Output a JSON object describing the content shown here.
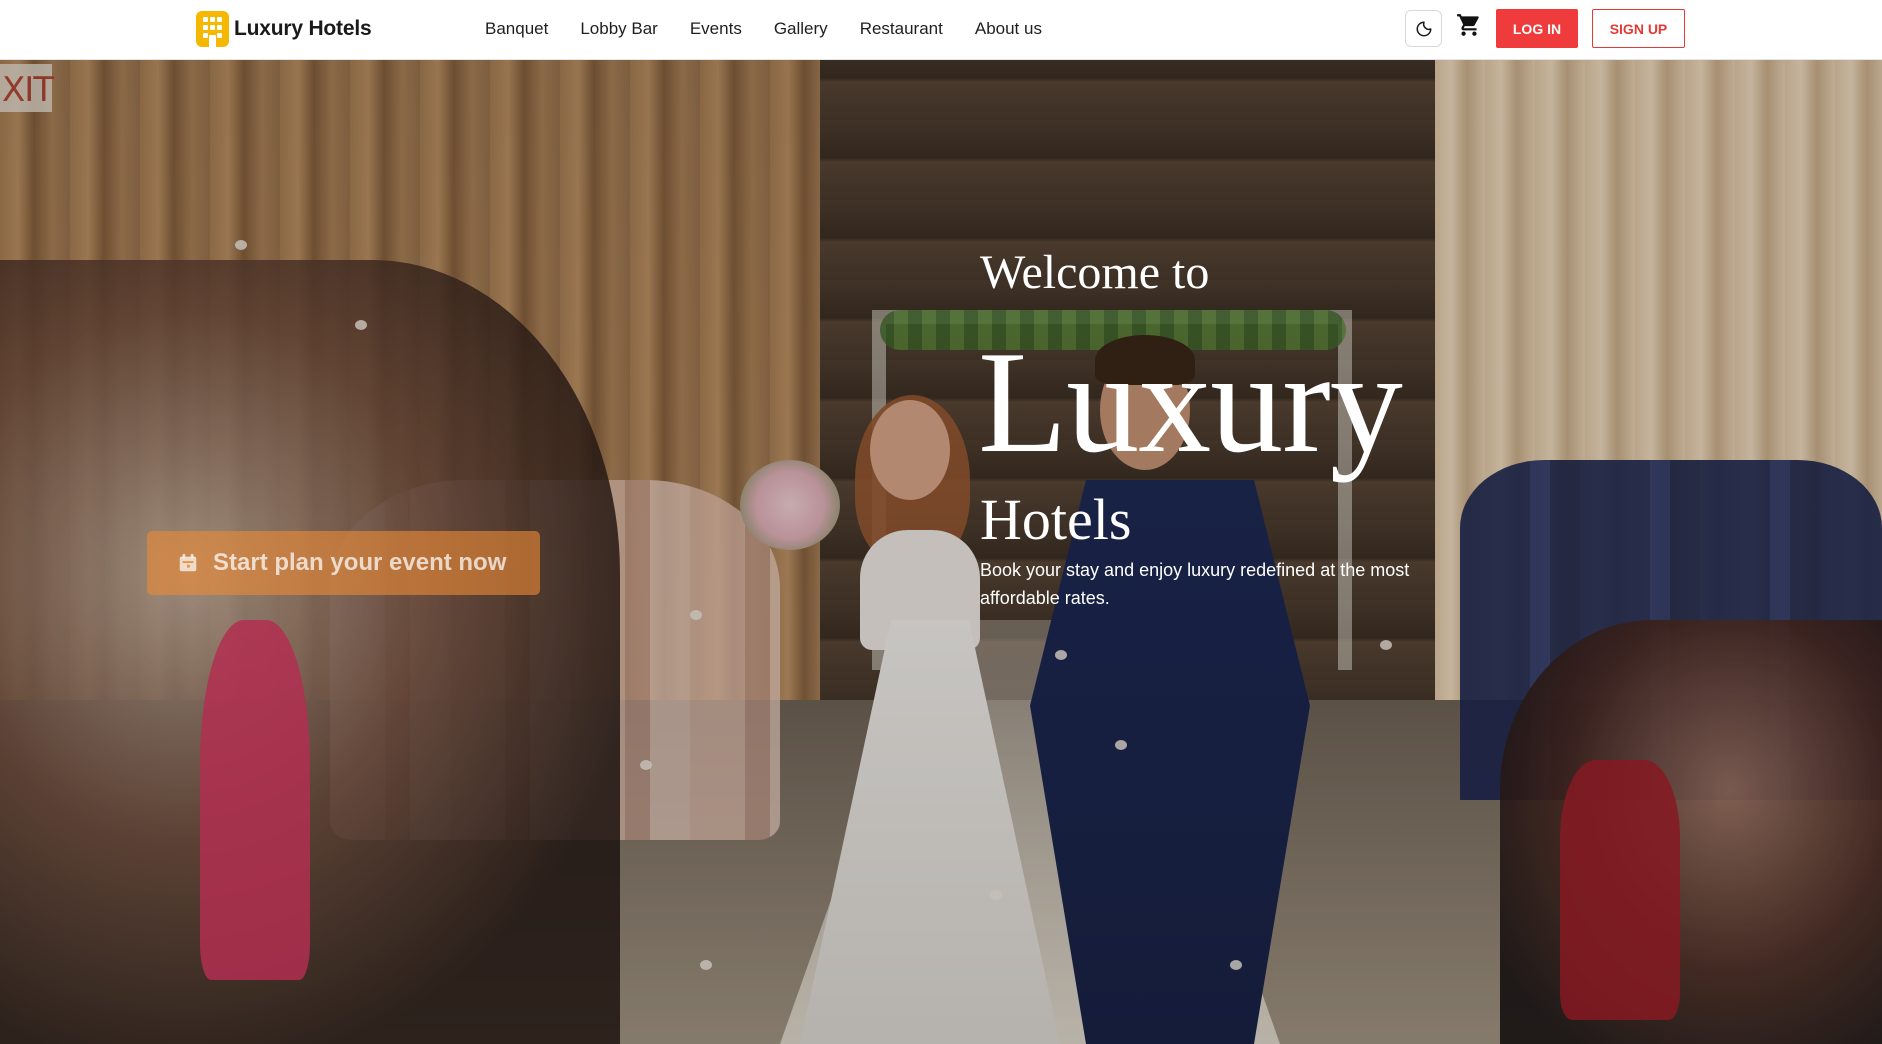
{
  "brand": {
    "name": "Luxury Hotels",
    "icon": "hotel-building-icon",
    "color": "#f5b700"
  },
  "nav": {
    "links": [
      "Banquet",
      "Lobby Bar",
      "Events",
      "Gallery",
      "Restaurant",
      "About us"
    ]
  },
  "actions": {
    "theme_icon": "moon-icon",
    "cart_icon": "shopping-cart-icon",
    "login_label": "LOG IN",
    "signup_label": "SIGN UP",
    "accent_color": "#ef3b3b"
  },
  "hero": {
    "welcome": "Welcome to",
    "title_line1": "Luxury",
    "title_line2": "Hotels",
    "subtitle": "Book your stay and enjoy luxury redefined at the most affordable rates.",
    "cta_label": "Start plan your event now",
    "cta_icon": "calendar-icon",
    "background": "wedding-ceremony-photo",
    "exit_sign": "XIT"
  }
}
